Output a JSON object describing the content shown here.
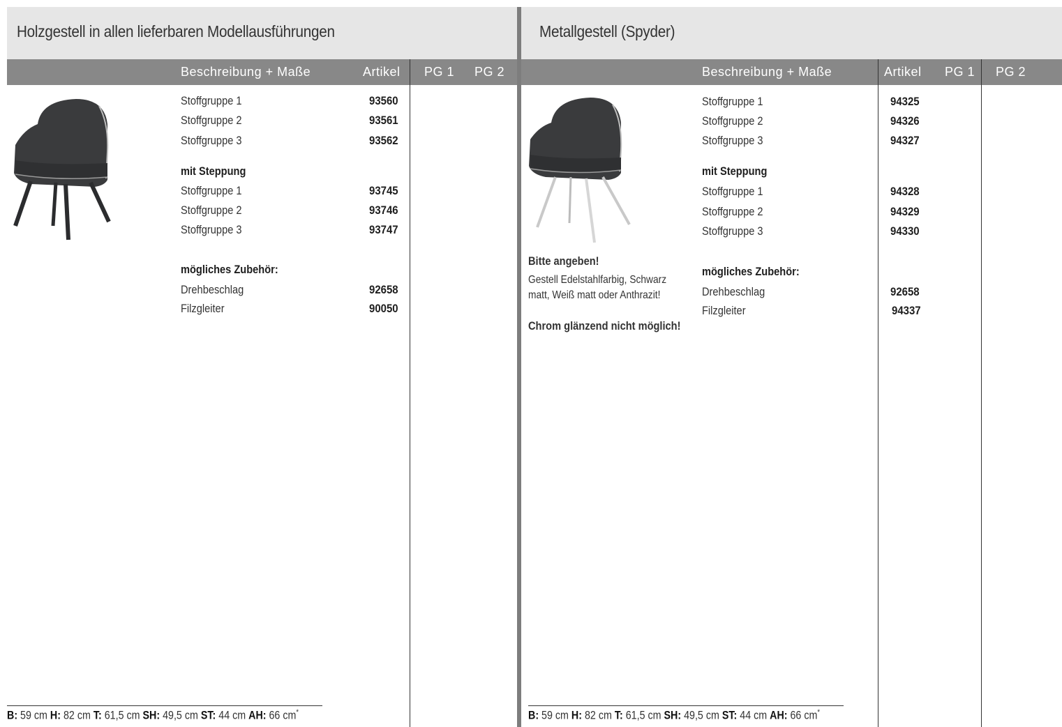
{
  "left": {
    "title": "Holzgestell in allen lieferbaren Modellausführungen",
    "columns": {
      "desc": "Beschreibung + Maße",
      "artikel": "Artikel",
      "pg1": "PG 1",
      "pg2": "PG 2"
    },
    "rows": [
      {
        "label": "Stoffgruppe 1",
        "artikel": "93560"
      },
      {
        "label": "Stoffgruppe 2",
        "artikel": "93561"
      },
      {
        "label": "Stoffgruppe 3",
        "artikel": "93562"
      },
      {
        "heading": "mit Steppung"
      },
      {
        "label": "Stoffgruppe 1",
        "artikel": "93745"
      },
      {
        "label": "Stoffgruppe 2",
        "artikel": "93746"
      },
      {
        "label": "Stoffgruppe 3",
        "artikel": "93747"
      },
      {
        "heading": "mögliches Zubehör:"
      },
      {
        "label": "Drehbeschlag",
        "artikel": "92658"
      },
      {
        "label": "Filzgleiter",
        "artikel": "90050"
      }
    ],
    "dimensions": {
      "b_label": "B:",
      "b": "59 cm",
      "h_label": "H:",
      "h": "82 cm",
      "t_label": "T:",
      "t": "61,5 cm",
      "sh_label": "SH:",
      "sh": "49,5 cm",
      "st_label": "ST:",
      "st": "44 cm",
      "ah_label": "AH:",
      "ah": "66 cm",
      "mark": "*"
    }
  },
  "right": {
    "title": "Metallgestell (Spyder)",
    "columns": {
      "desc": "Beschreibung + Maße",
      "artikel": "Artikel",
      "pg1": "PG 1",
      "pg2": "PG 2"
    },
    "rows": [
      {
        "label": "Stoffgruppe 1",
        "artikel": "94325"
      },
      {
        "label": "Stoffgruppe 2",
        "artikel": "94326"
      },
      {
        "label": "Stoffgruppe 3",
        "artikel": "94327"
      },
      {
        "heading": "mit Steppung"
      },
      {
        "label": "Stoffgruppe 1",
        "artikel": "94328"
      },
      {
        "label": "Stoffgruppe 2",
        "artikel": "94329"
      },
      {
        "label": "Stoffgruppe 3",
        "artikel": "94330"
      },
      {
        "heading": "mögliches Zubehör:"
      },
      {
        "label": "Drehbeschlag",
        "artikel": "92658"
      },
      {
        "label": "Filzgleiter",
        "artikel": "94337"
      }
    ],
    "notes": {
      "heading": "Bitte angeben!",
      "line1": "Gestell Edelstahlfarbig, Schwarz",
      "line2": "matt, Weiß matt oder Anthrazit!",
      "warning": "Chrom glänzend nicht möglich!"
    },
    "dimensions": {
      "b_label": "B:",
      "b": "59 cm",
      "h_label": "H:",
      "h": "82 cm",
      "t_label": "T:",
      "t": "61,5 cm",
      "sh_label": "SH:",
      "sh": "49,5 cm",
      "st_label": "ST:",
      "st": "44 cm",
      "ah_label": "AH:",
      "ah": "66 cm",
      "mark": "*"
    }
  }
}
